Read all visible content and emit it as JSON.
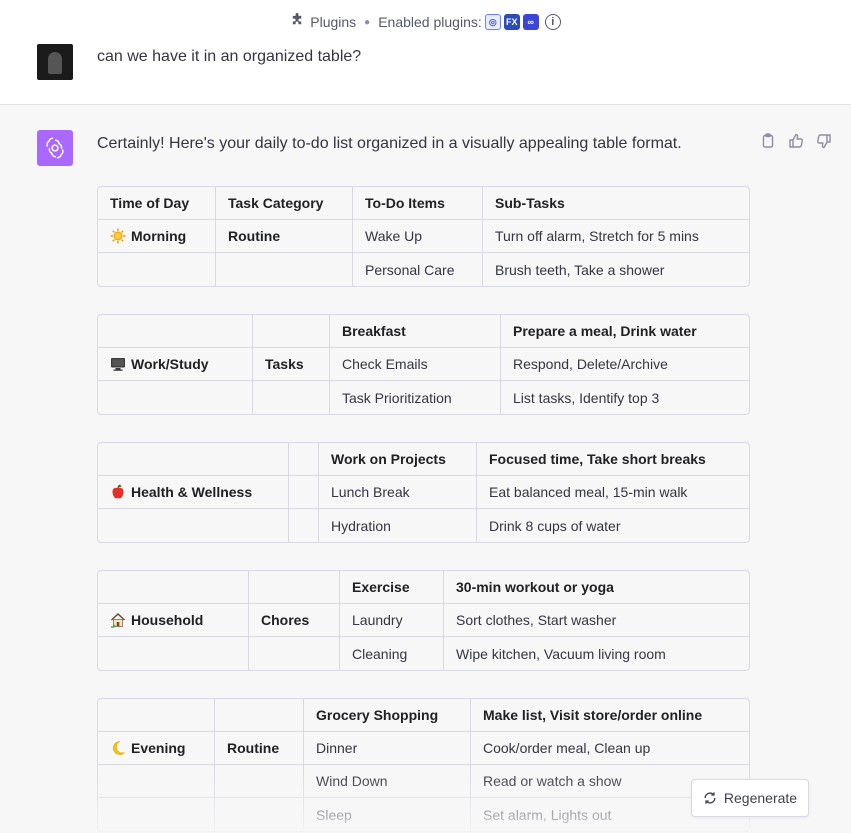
{
  "header": {
    "plugins_label": "Plugins",
    "enabled_label": "Enabled plugins:",
    "plugin_icons": [
      "plugin-1-icon",
      "fx-plugin-icon",
      "link-plugin-icon"
    ]
  },
  "user_message": {
    "text": "can we have it in an organized table?"
  },
  "assistant_message": {
    "intro": "Certainly! Here's your daily to-do list organized in a visually appealing table format."
  },
  "tables": [
    {
      "rows": [
        [
          "Time of Day",
          "Task Category",
          "To-Do Items",
          "Sub-Tasks"
        ],
        [
          "Morning",
          "Routine",
          "Wake Up",
          "Turn off alarm, Stretch for 5 mins"
        ],
        [
          "",
          "",
          "Personal Care",
          "Brush teeth, Take a shower"
        ]
      ]
    },
    {
      "rows": [
        [
          "",
          "",
          "Breakfast",
          "Prepare a meal, Drink water"
        ],
        [
          "Work/Study",
          "Tasks",
          "Check Emails",
          "Respond, Delete/Archive"
        ],
        [
          "",
          "",
          "Task Prioritization",
          "List tasks, Identify top 3"
        ]
      ]
    },
    {
      "rows": [
        [
          "",
          "",
          "Work on Projects",
          "Focused time, Take short breaks"
        ],
        [
          "Health & Wellness",
          "",
          "Lunch Break",
          "Eat balanced meal, 15-min walk"
        ],
        [
          "",
          "",
          "Hydration",
          "Drink 8 cups of water"
        ]
      ]
    },
    {
      "rows": [
        [
          "",
          "",
          "Exercise",
          "30-min workout or yoga"
        ],
        [
          "Household",
          "Chores",
          "Laundry",
          "Sort clothes, Start washer"
        ],
        [
          "",
          "",
          "Cleaning",
          "Wipe kitchen, Vacuum living room"
        ]
      ]
    },
    {
      "rows": [
        [
          "",
          "",
          "Grocery Shopping",
          "Make list, Visit store/order online"
        ],
        [
          "Evening",
          "Routine",
          "Dinner",
          "Cook/order meal, Clean up"
        ],
        [
          "",
          "",
          "Wind Down",
          "Read or watch a show"
        ],
        [
          "",
          "",
          "Sleep",
          "Set alarm, Lights out"
        ]
      ]
    }
  ],
  "regenerate_label": "Regenerate",
  "colors": {
    "accent": "#ab68ff",
    "border": "#d9d9e3",
    "background": "#f7f7f8"
  }
}
